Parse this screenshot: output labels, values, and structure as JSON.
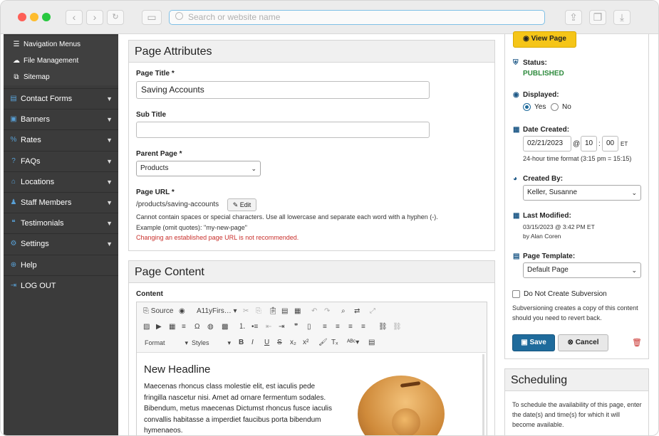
{
  "browser": {
    "url_placeholder": "Search or website name",
    "back_icon": "chevron-left-icon",
    "forward_icon": "chevron-right-icon"
  },
  "sidebar": {
    "subitems": [
      {
        "label": "Navigation Menus",
        "icon": "list-icon"
      },
      {
        "label": "File Management",
        "icon": "cloud-icon"
      },
      {
        "label": "Sitemap",
        "icon": "sitemap-icon"
      }
    ],
    "items": [
      {
        "label": "Contact Forms",
        "icon": "forms-icon"
      },
      {
        "label": "Banners",
        "icon": "banner-icon"
      },
      {
        "label": "Rates",
        "icon": "percent-icon"
      },
      {
        "label": "FAQs",
        "icon": "question-icon"
      },
      {
        "label": "Locations",
        "icon": "bank-icon"
      },
      {
        "label": "Staff Members",
        "icon": "users-icon"
      },
      {
        "label": "Testimonials",
        "icon": "comments-icon"
      },
      {
        "label": "Settings",
        "icon": "gears-icon"
      },
      {
        "label": "Help",
        "icon": "globe-icon"
      },
      {
        "label": "LOG OUT",
        "icon": "logout-icon"
      }
    ]
  },
  "attributes": {
    "heading": "Page Attributes",
    "title_label": "Page Title *",
    "title_value": "Saving Accounts",
    "subtitle_label": "Sub Title",
    "subtitle_value": "",
    "parent_label": "Parent Page *",
    "parent_value": "Products",
    "url_label": "Page URL *",
    "url_value": "/products/saving-accounts",
    "edit_label": "Edit",
    "help1": "Cannot contain spaces or special characters. Use all lowercase and separate each word with a hyphen (-).",
    "help2": "Example (omit quotes): \"my-new-page\"",
    "warning": "Changing an established page URL is not recommended."
  },
  "content": {
    "heading": "Page Content",
    "label": "Content",
    "toolbar": {
      "source": "Source",
      "font": "A11yFirs…",
      "format": "Format",
      "styles": "Styles"
    },
    "editor_headline": "New Headline",
    "editor_body": "Maecenas rhoncus class molestie elit, est iaculis pede fringilla nascetur nisi. Amet ad ornare fermentum sodales. Bibendum, metus maecenas Dictumst rhoncus fusce iaculis convallis habitasse a imperdiet faucibus porta bibendum hymenaeos."
  },
  "status_panel": {
    "view_page": "View Page",
    "status_label": "Status:",
    "status_value": "PUBLISHED",
    "displayed_label": "Displayed:",
    "yes": "Yes",
    "no": "No",
    "displayed_value": "Yes",
    "date_label": "Date Created:",
    "date_value": "02/21/2023",
    "at": "@",
    "hour": "10",
    "colon": ":",
    "minute": "00",
    "tz": "ET",
    "time_note": "24-hour time format (3:15 pm = 15:15)",
    "created_by_label": "Created By:",
    "created_by_value": "Keller, Susanne",
    "modified_label": "Last Modified:",
    "modified_value": "03/15/2023 @ 3:42 PM ET",
    "modified_by": "by Alan Coren",
    "template_label": "Page Template:",
    "template_value": "Default Page",
    "subversion_label": "Do Not Create Subversion",
    "subversion_note": "Subversioning creates a copy of this content should you need to revert back.",
    "save": "Save",
    "cancel": "Cancel"
  },
  "scheduling": {
    "heading": "Scheduling",
    "text": "To schedule the availability of this page, enter the date(s) and time(s) for which it will become available."
  },
  "colors": {
    "accent": "#1f6b9c",
    "published": "#2e8b3d",
    "view_btn": "#f5c518",
    "warning": "#c9302c",
    "sidebar": "#3b3b3b"
  }
}
